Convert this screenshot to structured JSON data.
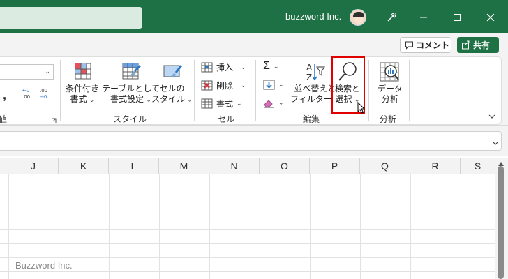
{
  "titlebar": {
    "account_name": "buzzword Inc.",
    "icons": [
      "avatar",
      "magic-wand-icon",
      "minimize-icon",
      "maximize-icon",
      "close-icon"
    ]
  },
  "ribbon_top": {
    "comment_label": "コメント",
    "share_label": "共有"
  },
  "ribbon": {
    "partial_left_label": "値",
    "styles": {
      "conditional_format": {
        "line1": "条件付き",
        "line2": "書式"
      },
      "format_table": {
        "line1": "テーブルとして",
        "line2": "書式設定"
      },
      "cell_styles": {
        "line1": "セルの",
        "line2": "スタイル"
      },
      "group_label": "スタイル"
    },
    "cells": {
      "insert": "挿入",
      "delete": "削除",
      "format": "書式",
      "group_label": "セル"
    },
    "editing": {
      "sort_filter": {
        "line1": "並べ替えと",
        "line2": "フィルター"
      },
      "find_select": {
        "line1": "検索と",
        "line2": "選択"
      },
      "group_label": "編集"
    },
    "analysis": {
      "analyze_data": {
        "line1": "データ",
        "line2": "分析"
      },
      "group_label": "分析"
    },
    "number": {
      "comma": ",",
      "dec_increase": "←0\n.00",
      "dec_decrease": ".00\n→0"
    }
  },
  "grid": {
    "columns": [
      "J",
      "K",
      "L",
      "M",
      "N",
      "O",
      "P",
      "Q",
      "R",
      "S"
    ]
  },
  "watermark": "Buzzword Inc.",
  "colors": {
    "excel_green": "#1e7145",
    "highlight_red": "#e00000"
  }
}
